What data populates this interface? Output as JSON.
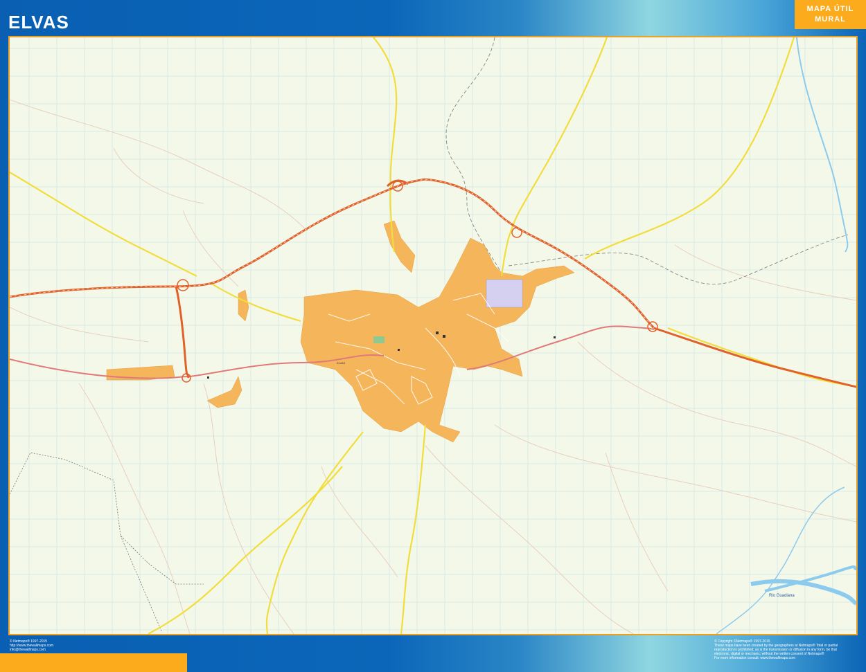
{
  "header": {
    "title": "ELVAS",
    "badge_line1": "MAPA ÚTIL",
    "badge_line2": "MURAL"
  },
  "map": {
    "city_label": "ELVAS",
    "river_label": "Rio Guadiana",
    "colors": {
      "background": "#f4f8e8",
      "urban": "#f5b55a",
      "highway": "#e0612a",
      "main_road": "#f1dd3c",
      "secondary_road": "#e07a7a",
      "minor_road": "#e8cfc0",
      "river": "#8ccbee",
      "grid": "#cfe6ea",
      "frame_border": "#f0a020"
    }
  },
  "footer": {
    "left_lines": [
      "© Netmaps® 1997-2015",
      "http://www.thewallmaps.com",
      "info@thewallmaps.com"
    ],
    "right_lines": [
      "© Copyright ©Netmaps® 1997-2015",
      "These maps have been created by the geographers at Netmaps® Total or partial",
      "reproduction is prohibited; as is the transmission or diffusion in any form, be that",
      "electronic, digital or mechanic; without the written consent of Netmaps®",
      "For more information consult: www.thewallmaps.com"
    ]
  }
}
